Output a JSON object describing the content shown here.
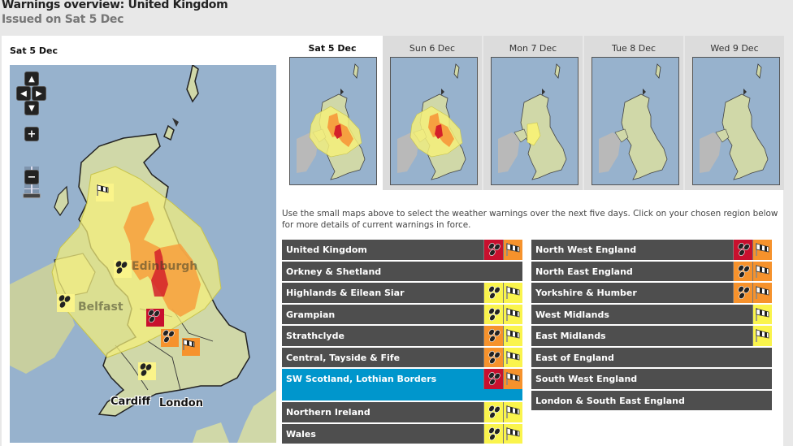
{
  "header": {
    "title": "Warnings overview: United Kingdom",
    "issued": "Issued on Sat 5 Dec"
  },
  "main_map": {
    "date_label": "Sat 5 Dec",
    "controls": {
      "pan_up": "▲",
      "pan_left": "◀",
      "pan_right": "▶",
      "pan_down": "▼",
      "zoom_in": "+",
      "zoom_out": "−"
    },
    "city_labels": [
      "Edinburgh",
      "Belfast",
      "Cardiff",
      "London"
    ],
    "colors": {
      "sea": "#97b2cd",
      "land": "#d0d8a8",
      "ireland": "#b9b9b9",
      "yellow_warning": "#f5f07a",
      "orange_warning": "#f6a040",
      "red_warning": "#d4202a"
    }
  },
  "day_tabs": [
    {
      "label": "Sat 5 Dec",
      "active": true,
      "warnings": [
        "yellow",
        "orange",
        "red"
      ]
    },
    {
      "label": "Sun 6 Dec",
      "active": false,
      "warnings": [
        "yellow",
        "orange",
        "red"
      ]
    },
    {
      "label": "Mon 7 Dec",
      "active": false,
      "warnings": [
        "yellow"
      ]
    },
    {
      "label": "Tue 8 Dec",
      "active": false,
      "warnings": []
    },
    {
      "label": "Wed 9 Dec",
      "active": false,
      "warnings": []
    }
  ],
  "instructions": "Use the small maps above to select the weather warnings over the next five days. Click on your chosen region below for more details of current warnings in force.",
  "regions_left": [
    {
      "name": "United Kingdom",
      "rain": "red",
      "wind": "orange"
    },
    {
      "name": "Orkney & Shetland",
      "rain": null,
      "wind": null
    },
    {
      "name": "Highlands & Eilean Siar",
      "rain": "yellow",
      "wind": "yellow"
    },
    {
      "name": "Grampian",
      "rain": "yellow",
      "wind": "yellow"
    },
    {
      "name": "Strathclyde",
      "rain": "orange",
      "wind": "yellow"
    },
    {
      "name": "Central, Tayside & Fife",
      "rain": "orange",
      "wind": "yellow"
    },
    {
      "name": "SW Scotland, Lothian Borders",
      "rain": "red",
      "wind": "orange",
      "selected": true
    },
    {
      "name": "Northern Ireland",
      "rain": "yellow",
      "wind": "yellow"
    },
    {
      "name": "Wales",
      "rain": "yellow",
      "wind": "yellow"
    }
  ],
  "regions_right": [
    {
      "name": "North West England",
      "rain": "red",
      "wind": "orange"
    },
    {
      "name": "North East England",
      "rain": "orange",
      "wind": "orange"
    },
    {
      "name": "Yorkshire & Humber",
      "rain": "orange",
      "wind": "orange"
    },
    {
      "name": "West Midlands",
      "rain": null,
      "wind": "yellow"
    },
    {
      "name": "East Midlands",
      "rain": null,
      "wind": "yellow"
    },
    {
      "name": "East of England",
      "rain": null,
      "wind": null
    },
    {
      "name": "South West England",
      "rain": null,
      "wind": null
    },
    {
      "name": "London & South East England",
      "rain": null,
      "wind": null
    }
  ],
  "icons": {
    "rain": "rain-icon",
    "wind": "wind-icon"
  }
}
